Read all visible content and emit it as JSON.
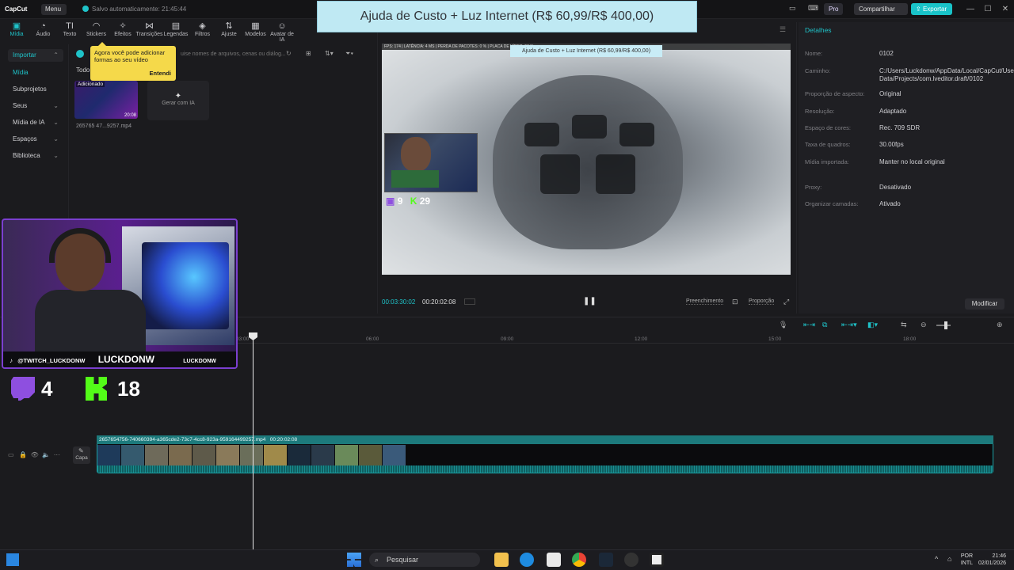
{
  "titlebar": {
    "app_name": "CapCut",
    "menu_label": "Menu",
    "saved_status": "Salvo automaticamente: 21:45:44",
    "pro_label": "Pro",
    "share_label": "Compartilhar",
    "export_label": "Exportar"
  },
  "overlay_banner": "Ajuda de Custo + Luz Internet (R$ 60,99/R$ 400,00)",
  "toolbar": {
    "items": [
      {
        "label": "Mídia",
        "icon": "media-icon"
      },
      {
        "label": "Áudio",
        "icon": "audio-icon"
      },
      {
        "label": "Texto",
        "icon": "text-icon"
      },
      {
        "label": "Stickers",
        "icon": "sticker-icon"
      },
      {
        "label": "Efeitos",
        "icon": "effects-icon"
      },
      {
        "label": "Transições",
        "icon": "transition-icon"
      },
      {
        "label": "Legendas",
        "icon": "captions-icon"
      },
      {
        "label": "Filtros",
        "icon": "filter-icon"
      },
      {
        "label": "Ajuste",
        "icon": "adjust-icon"
      },
      {
        "label": "Modelos",
        "icon": "templates-icon"
      },
      {
        "label": "Avatar de IA",
        "icon": "avatar-icon"
      }
    ]
  },
  "leftnav": {
    "items": [
      "Importar",
      "Mídia",
      "Subprojetos",
      "Seus",
      "Mídia de IA",
      "Espaços",
      "Biblioteca"
    ]
  },
  "media": {
    "search_placeholder": "uise nomes de arquivos, cenas ou diálog...",
    "tooltip_text": "Agora você pode adicionar formas ao seu vídeo",
    "tooltip_ok": "Entendi",
    "section_label": "Todo",
    "thumb_badge": "Adicionado",
    "thumb_duration": "20:08",
    "file_name": "265765 47...9257.mp4",
    "generate_label": "Gerar com IA"
  },
  "player": {
    "hud_text": "FPS: 174 | LATÊNCIA: 4 MS | PERDA DE PACOTES: 0 % | PLACA DE VÍDEO: 56 %",
    "inner_banner": "Ajuda de Custo + Luz Internet (R$ 60,99/R$ 400,00)",
    "mini_twitch": "9",
    "mini_kick": "29",
    "time_current": "00:03:30:02",
    "time_total": "00:20:02:08",
    "fill_label": "Preenchimento",
    "ratio_label": "Proporção"
  },
  "details": {
    "title": "Detalhes",
    "rows": [
      {
        "label": "Nome:",
        "value": "0102"
      },
      {
        "label": "Caminho:",
        "value": "C:/Users/Luckdonw/AppData/Local/CapCut/User Data/Projects/com.lveditor.draft/0102"
      },
      {
        "label": "Proporção de aspecto:",
        "value": "Original"
      },
      {
        "label": "Resolução:",
        "value": "Adaptado"
      },
      {
        "label": "Espaço de cores:",
        "value": "Rec. 709 SDR"
      },
      {
        "label": "Taxa de quadros:",
        "value": "30.00fps"
      },
      {
        "label": "Mídia importada:",
        "value": "Manter no local original"
      },
      {
        "label": "Proxy:",
        "value": "Desativado"
      },
      {
        "label": "Organizar camadas:",
        "value": "Ativado"
      }
    ],
    "modify_label": "Modificar"
  },
  "timeline": {
    "ticks": [
      "03:00",
      "06:00",
      "09:00",
      "12:00",
      "15:00",
      "18:00"
    ],
    "clip_name": "2657654756-740660394-a365cde2-73c7-4cc8-923a-959164499257.mp4",
    "clip_duration": "00:20:02:08",
    "cover_label": "Capa"
  },
  "webcam": {
    "handle": "@TWITCH_LUCKDONW",
    "name_big": "LUCKDONW",
    "name_small": "LUCKDONW",
    "twitch_count": "4",
    "kick_count": "18"
  },
  "taskbar": {
    "search_label": "Pesquisar",
    "lang": "POR",
    "layout": "INTL",
    "time": "21:46",
    "date": "02/01/2026"
  },
  "colors": {
    "accent": "#1fc3c9",
    "twitch": "#8e4fe0",
    "kick": "#53fc18"
  }
}
